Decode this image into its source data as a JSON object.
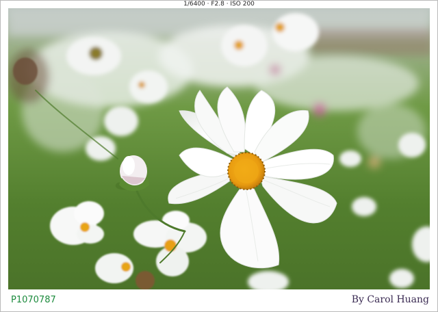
{
  "exif": "1/6400 · F2.8 · ISO 200",
  "photo_id": "P1070787",
  "credit": "By Carol Huang",
  "colors": {
    "caption_id": "#1b8a3c",
    "caption_credit": "#3a2a52",
    "petal": "#ffffff",
    "center": "#f2a514",
    "grass": "#5f8d3a"
  }
}
